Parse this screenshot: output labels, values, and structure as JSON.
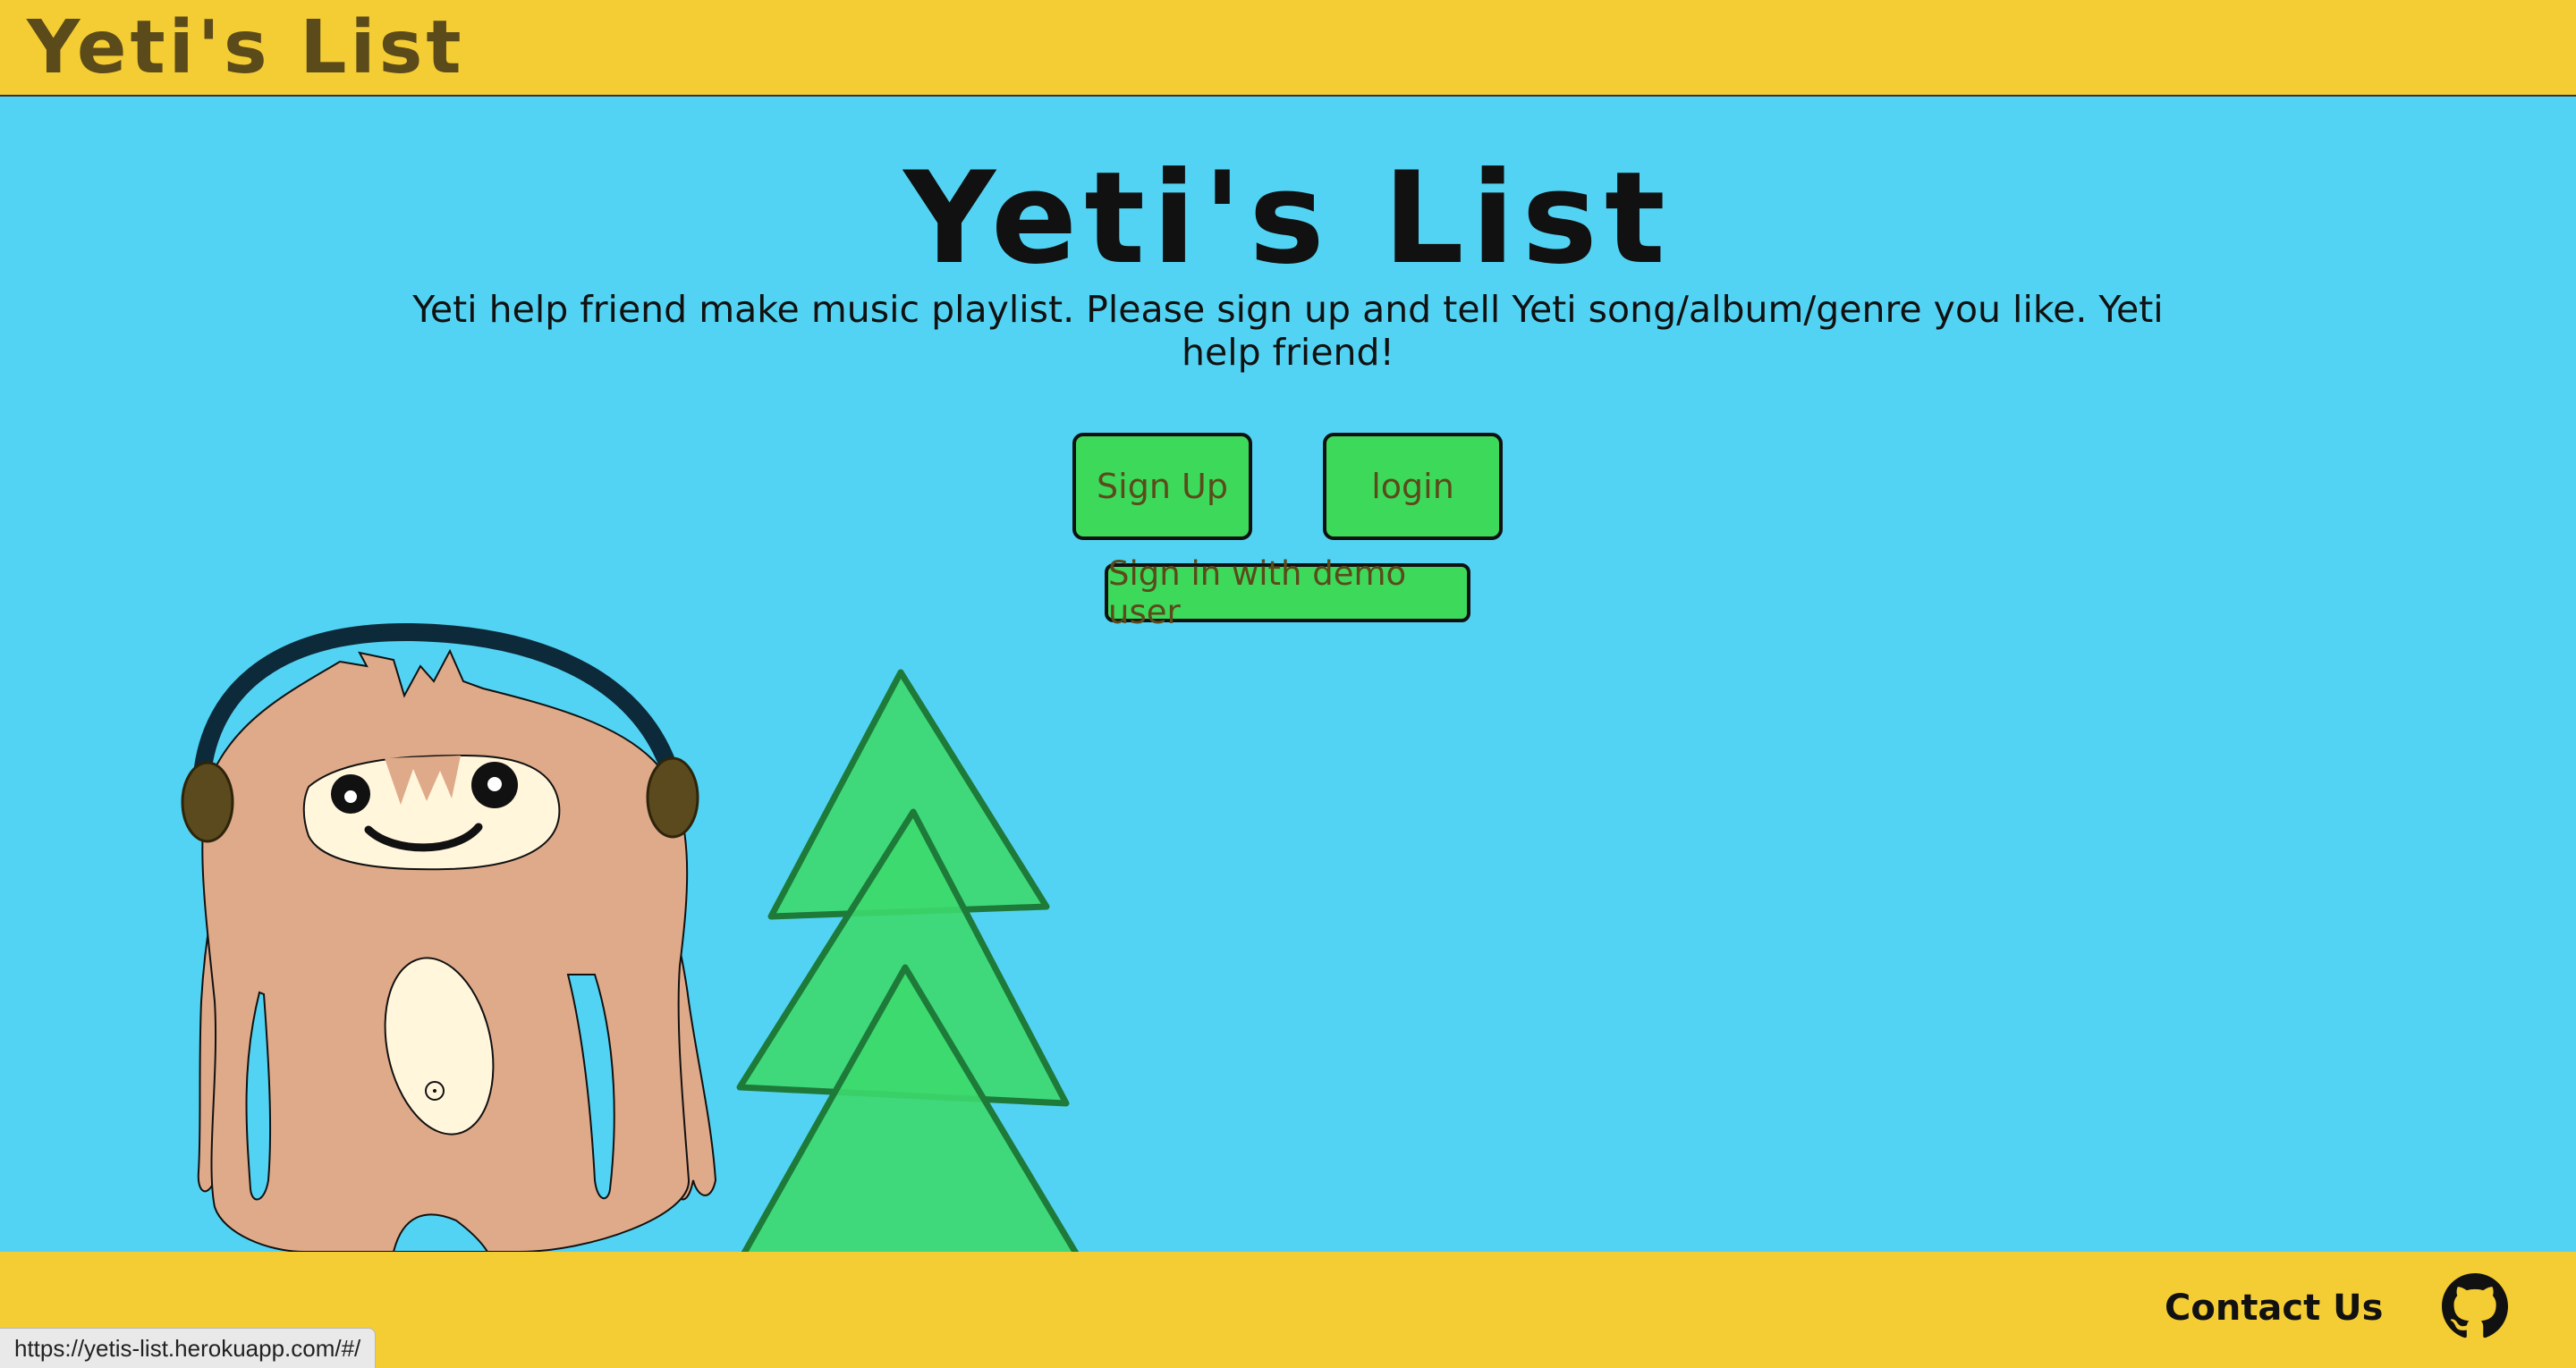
{
  "header": {
    "brand": "Yeti's List"
  },
  "hero": {
    "title": "Yeti's List",
    "description": "Yeti help friend make music playlist. Please sign up and tell Yeti song/album/genre you like. Yeti help friend!"
  },
  "auth": {
    "signup_label": "Sign Up",
    "login_label": "login",
    "demo_label": "Sign in with demo user"
  },
  "footer": {
    "contact_label": "Contact Us",
    "github_icon": "github-icon"
  },
  "status_bar": {
    "url": "https://yetis-list.herokuapp.com/#/"
  },
  "colors": {
    "sky": "#53d3f3",
    "bar": "#f4cd34",
    "button": "#3dd95b",
    "tree": "#3dd96e",
    "yeti_fur": "#dfaa8a"
  }
}
